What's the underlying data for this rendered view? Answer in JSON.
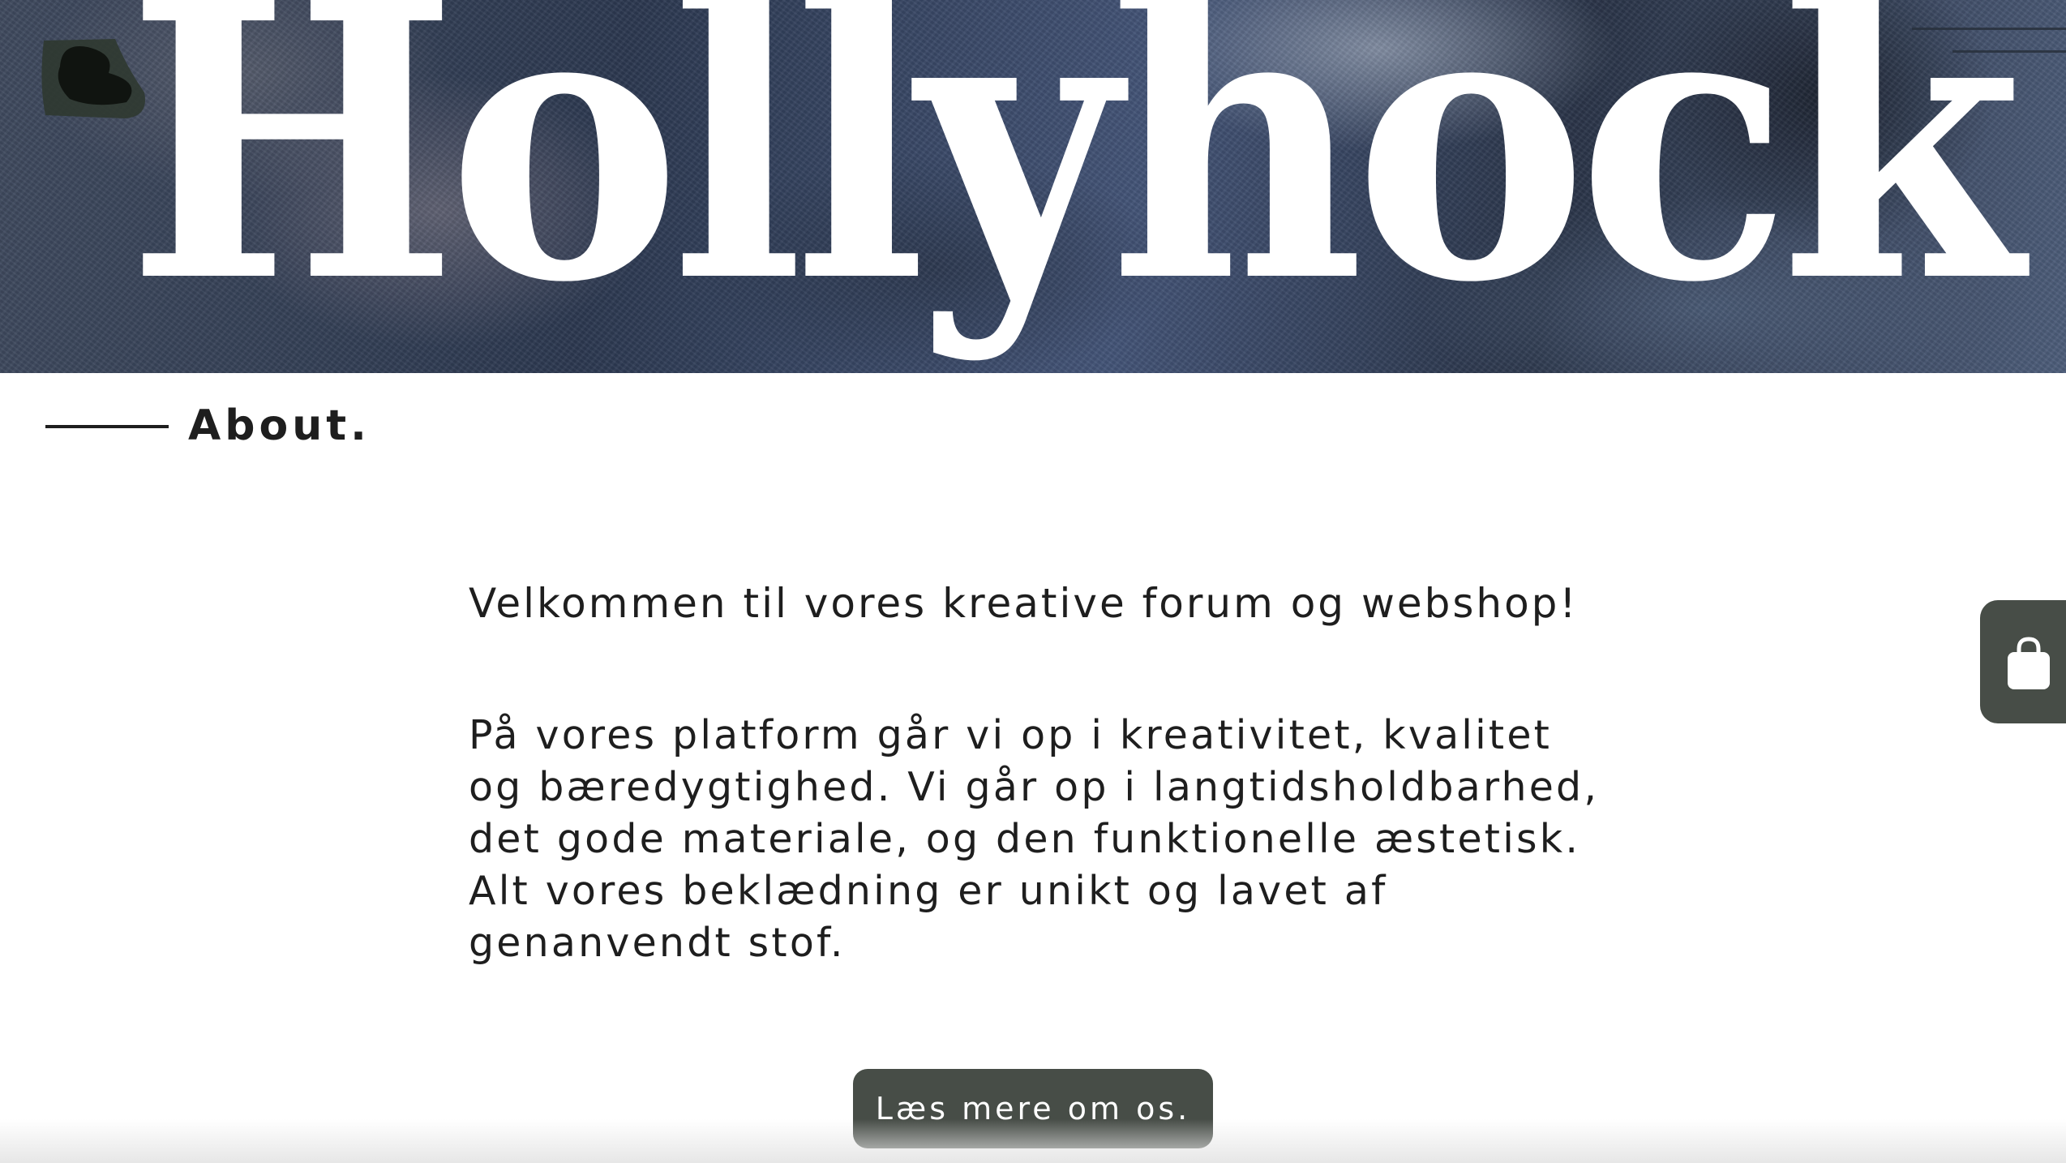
{
  "hero": {
    "title": "Hollyhock"
  },
  "header": {
    "menu_icon": "hamburger-icon",
    "logo_icon": "brand-leaf-icon"
  },
  "about": {
    "section_label": "About.",
    "intro": "Velkommen til vores kreative forum og webshop!",
    "body_lines": [
      "På vores platform går vi op i kreativitet, kvalitet",
      "og bæredygtighed. Vi går op i langtidsholdbarhed,",
      "det gode materiale, og den funktionelle æstetisk.",
      "Alt vores beklædning er unikt og lavet af",
      "genanvendt stof."
    ],
    "cta_label": "Læs mere om os."
  },
  "cart": {
    "icon": "shopping-bag-icon"
  },
  "colors": {
    "text": "#1e1e1e",
    "button_bg": "#474d47",
    "button_text": "#ffffff",
    "background": "#ffffff"
  }
}
